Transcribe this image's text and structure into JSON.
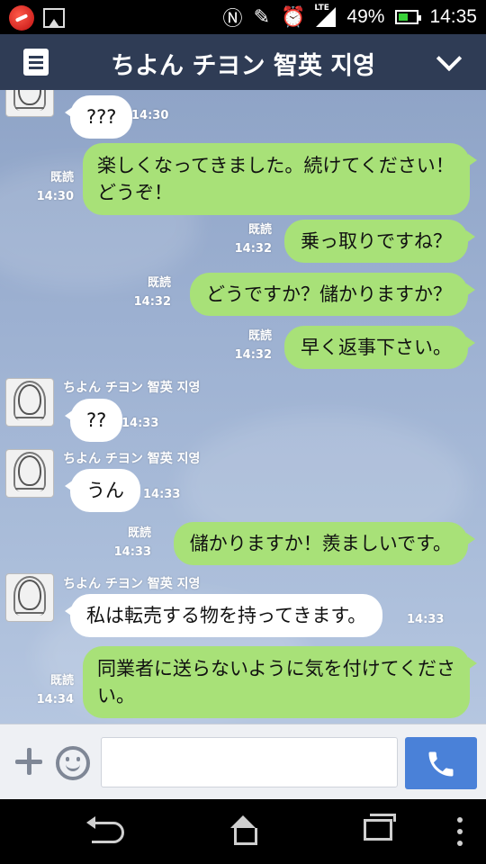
{
  "status_bar": {
    "battery": "49%",
    "time": "14:35",
    "network": "LTE"
  },
  "header": {
    "title": "ちよん チヨン 智英 지영"
  },
  "chat": {
    "messages": [
      {
        "side": "in",
        "text": "???",
        "time": "14:30"
      },
      {
        "side": "out",
        "text": "楽しくなってきました。続けてください！どうぞ！",
        "read": "既読",
        "time": "14:30"
      },
      {
        "side": "out",
        "text": "乗っ取りですね？",
        "read": "既読",
        "time": "14:32"
      },
      {
        "side": "out",
        "text": "どうですか？儲かりますか？",
        "read": "既読",
        "time": "14:32"
      },
      {
        "side": "out",
        "text": "早く返事下さい。",
        "read": "既読",
        "time": "14:32"
      },
      {
        "side": "in",
        "sender": "ちよん チヨン 智英 지영",
        "text": "??",
        "time": "14:33"
      },
      {
        "side": "in",
        "sender": "ちよん チヨン 智英 지영",
        "text": "うん",
        "time": "14:33"
      },
      {
        "side": "out",
        "text": "儲かりますか！羨ましいです。",
        "read": "既読",
        "time": "14:33"
      },
      {
        "side": "in",
        "sender": "ちよん チヨン 智英 지영",
        "text": "私は転売する物を持ってきます。",
        "time": "14:33"
      },
      {
        "side": "out",
        "text": "同業者に送らないように気を付けてください。",
        "read": "既読",
        "time": "14:34"
      }
    ]
  },
  "input": {
    "value": "",
    "placeholder": ""
  },
  "icons": {
    "menu": "note-icon",
    "collapse": "chevron-down-icon",
    "attach": "plus-icon",
    "sticker": "smiley-icon",
    "call": "phone-icon",
    "back": "back-icon",
    "home": "home-icon",
    "recent": "recent-apps-icon",
    "more": "more-icon"
  },
  "colors": {
    "header": "#2f3c55",
    "outgoing_bubble": "#a8e178",
    "incoming_bubble": "#ffffff",
    "call_button": "#4a81d8"
  }
}
